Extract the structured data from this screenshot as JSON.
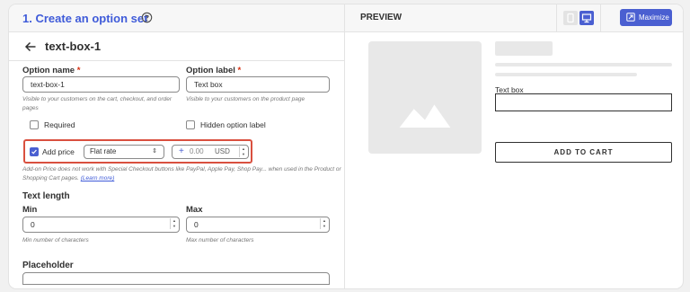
{
  "header": {
    "title": "1. Create an option set"
  },
  "subheader": {
    "title": "text-box-1"
  },
  "option_name": {
    "label": "Option name",
    "required_mark": "*",
    "value": "text-box-1",
    "hint": "Visible to your customers on the cart, checkout, and order pages"
  },
  "option_label": {
    "label": "Option label",
    "required_mark": "*",
    "value": "Text box",
    "hint": "Visible to your customers on the product page"
  },
  "required": {
    "label": "Required",
    "checked": false
  },
  "hidden_label": {
    "label": "Hidden option label",
    "checked": false
  },
  "add_price": {
    "label": "Add price",
    "checked": true,
    "type_value": "Flat rate",
    "plus": "+",
    "amount_placeholder": "0.00",
    "currency": "USD"
  },
  "addon_note": {
    "text": "Add-on Price does not work with Special Checkout buttons like PayPal, Apple Pay, Shop Pay... when used in the Product or Shopping Cart pages.",
    "link": "(Learn more)"
  },
  "text_length": {
    "heading": "Text length",
    "min": {
      "label": "Min",
      "value": "0",
      "hint": "Min number of characters"
    },
    "max": {
      "label": "Max",
      "value": "0",
      "hint": "Max number of characters"
    }
  },
  "placeholder": {
    "label": "Placeholder"
  },
  "preview": {
    "title": "PREVIEW",
    "maximize_label": "Maximize",
    "field_label": "Text box",
    "add_to_cart": "ADD TO CART"
  },
  "colors": {
    "accent": "#4a5fd1",
    "highlight": "#d9503f",
    "required": "#d72c0d",
    "title": "#3f5bd9"
  }
}
